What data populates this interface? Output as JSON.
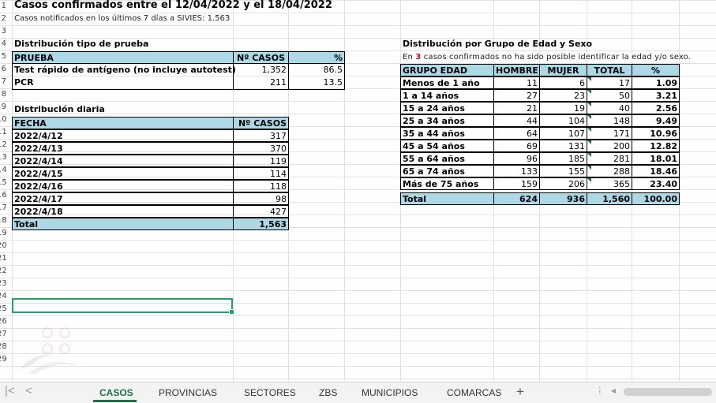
{
  "sheet": {
    "title": "Casos confirmados entre el 12/04/2022 y el 18/04/2022",
    "subtitle": "Casos notificados en los últimos 7 días a SIVIES: 1.563"
  },
  "prueba": {
    "section_title": "Distribución tipo de prueba",
    "headers": [
      "PRUEBA",
      "Nº CASOS",
      "%"
    ],
    "rows": [
      [
        "Test rápido de antígeno (no incluye autotest)",
        "1,352",
        "86.5"
      ],
      [
        "PCR",
        "211",
        "13.5"
      ]
    ]
  },
  "diaria": {
    "section_title": "Distribución diaria",
    "headers": [
      "FECHA",
      "Nº CASOS"
    ],
    "rows": [
      [
        "2022/4/12",
        "317"
      ],
      [
        "2022/4/13",
        "370"
      ],
      [
        "2022/4/14",
        "119"
      ],
      [
        "2022/4/15",
        "114"
      ],
      [
        "2022/4/16",
        "118"
      ],
      [
        "2022/4/17",
        "98"
      ],
      [
        "2022/4/18",
        "427"
      ]
    ],
    "total": [
      "Total",
      "1,563"
    ]
  },
  "edad": {
    "section_title": "Distribución por Grupo de Edad y Sexo",
    "note_pre": "En",
    "note_num": "3",
    "note_post": "casos confirmados no ha sido posible identificar la edad y/o sexo.",
    "headers": [
      "GRUPO EDAD",
      "HOMBRE",
      "MUJER",
      "TOTAL",
      "%"
    ],
    "rows": [
      [
        "Menos de 1 año",
        "11",
        "6",
        "17",
        "1.09"
      ],
      [
        "1 a 14 años",
        "27",
        "23",
        "50",
        "3.21"
      ],
      [
        "15 a 24 años",
        "21",
        "19",
        "40",
        "2.56"
      ],
      [
        "25 a 34 años",
        "44",
        "104",
        "148",
        "9.49"
      ],
      [
        "35 a 44 años",
        "64",
        "107",
        "171",
        "10.96"
      ],
      [
        "45 a 54 años",
        "69",
        "131",
        "200",
        "12.82"
      ],
      [
        "55 a 64 años",
        "96",
        "185",
        "281",
        "18.01"
      ],
      [
        "65 a 74 años",
        "133",
        "155",
        "288",
        "18.46"
      ],
      [
        "Más de 75 años",
        "159",
        "206",
        "365",
        "23.40"
      ]
    ],
    "total": [
      "Total",
      "624",
      "936",
      "1,560",
      "100.00"
    ]
  },
  "row_numbers": [
    "1",
    "2",
    "3",
    "4",
    "5",
    "6",
    "7",
    "8",
    "9",
    "10",
    "11",
    "12",
    "13",
    "14",
    "15",
    "16",
    "17",
    "18",
    "19",
    "20",
    "21",
    "22",
    "23",
    "24",
    "25",
    "26",
    "27",
    "28",
    "29"
  ],
  "tabs": [
    "CASOS",
    "PROVINCIAS",
    "SECTORES",
    "ZBS",
    "MUNICIPIOS",
    "COMARCAS"
  ],
  "active_tab": "CASOS",
  "add_sheet": "+",
  "colors": {
    "header_fill": "#add8e6",
    "active_tab": "#1e7145",
    "selection": "#21a366",
    "note_number": "#d0021b"
  },
  "icons": [
    "first-sheet-icon",
    "prev-sheet-icon",
    "add-sheet-icon"
  ]
}
